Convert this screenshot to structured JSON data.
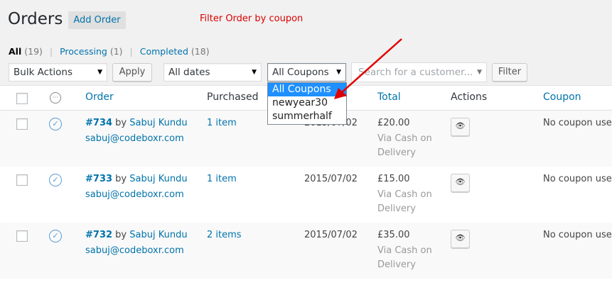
{
  "header": {
    "title": "Orders",
    "add_button": "Add Order",
    "annotation": "Filter Order by coupon"
  },
  "views": [
    {
      "label": "All",
      "count": "(19)",
      "current": true
    },
    {
      "label": "Processing",
      "count": "(1)",
      "current": false
    },
    {
      "label": "Completed",
      "count": "(18)",
      "current": false
    }
  ],
  "toolbar": {
    "bulk_actions": "Bulk Actions",
    "apply": "Apply",
    "dates": "All dates",
    "coupons": "All Coupons",
    "customer_placeholder": "Search for a customer...",
    "filter": "Filter"
  },
  "coupon_dropdown": {
    "options": [
      "All Coupons",
      "newyear30",
      "summerhalf"
    ],
    "selected_index": 0
  },
  "columns": {
    "order": "Order",
    "purchased": "Purchased",
    "total": "Total",
    "actions": "Actions",
    "coupon": "Coupon"
  },
  "rows": [
    {
      "order": "#734",
      "by": "by",
      "customer": "Sabuj Kundu",
      "email": "sabuj@codeboxr.com",
      "purchased": "1 item",
      "date": "2015/07/02",
      "total": "£20.00",
      "via1": "Via Cash on",
      "via2": "Delivery",
      "coupon": "No coupon used"
    },
    {
      "order": "#733",
      "by": "by",
      "customer": "Sabuj Kundu",
      "email": "sabuj@codeboxr.com",
      "purchased": "1 item",
      "date": "2015/07/02",
      "total": "£15.00",
      "via1": "Via Cash on",
      "via2": "Delivery",
      "coupon": "No coupon used"
    },
    {
      "order": "#732",
      "by": "by",
      "customer": "Sabuj Kundu",
      "email": "sabuj@codeboxr.com",
      "purchased": "2 items",
      "date": "2015/07/02",
      "total": "£35.00",
      "via1": "Via Cash on",
      "via2": "Delivery",
      "coupon": "No coupon used"
    }
  ],
  "icons": {
    "status_header": "status-dots-icon",
    "status_row": "processing-check-icon",
    "action": "eye-icon"
  },
  "colors": {
    "link": "#0073aa",
    "annotation": "#dd0000",
    "arrow": "#e00000",
    "dropdown_selected": "#1e90ff"
  }
}
